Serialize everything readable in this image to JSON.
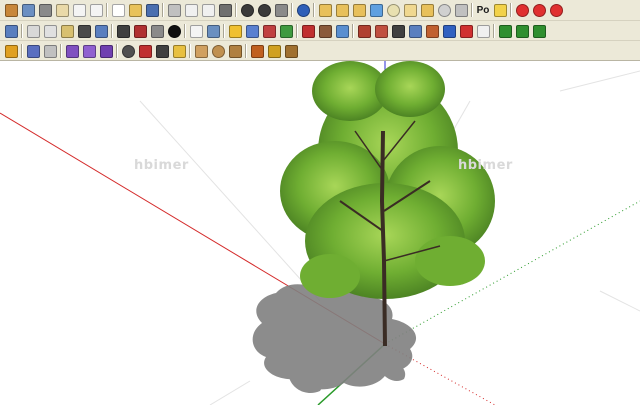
{
  "toolbar": {
    "row1": [
      {
        "name": "box-icon",
        "color": "#c8873a",
        "shape": "square"
      },
      {
        "name": "book-icon",
        "color": "#6b8fc2",
        "shape": "square"
      },
      {
        "name": "house-icon",
        "color": "#8a8a8a",
        "shape": "square"
      },
      {
        "name": "box-front-icon",
        "color": "#e9d9a8",
        "shape": "square"
      },
      {
        "name": "house-outline-icon",
        "color": "#f4f4f4",
        "shape": "square"
      },
      {
        "name": "house-outline-2-icon",
        "color": "#f4f4f4",
        "shape": "square"
      },
      {
        "sep": true
      },
      {
        "name": "new-file-icon",
        "color": "#ffffff",
        "shape": "square"
      },
      {
        "name": "open-folder-icon",
        "color": "#e8c25a",
        "shape": "square"
      },
      {
        "name": "save-disk-icon",
        "color": "#4a6fb0",
        "shape": "square"
      },
      {
        "sep": true
      },
      {
        "name": "cut-scissors-icon",
        "color": "#c0c0c0",
        "shape": "square"
      },
      {
        "name": "copy-icon",
        "color": "#f0f0f0",
        "shape": "square"
      },
      {
        "name": "paste-icon",
        "color": "#f0f0f0",
        "shape": "square"
      },
      {
        "name": "delete-x-icon",
        "color": "#6f6f6f",
        "shape": "square"
      },
      {
        "sep": true
      },
      {
        "name": "undo-icon",
        "color": "#3a3a3a",
        "shape": "circle"
      },
      {
        "name": "redo-icon",
        "color": "#3a3a3a",
        "shape": "circle"
      },
      {
        "name": "print-icon",
        "color": "#8a8a8a",
        "shape": "square"
      },
      {
        "sep": true
      },
      {
        "name": "model-info-icon",
        "color": "#2f5fb8",
        "shape": "circle"
      },
      {
        "sep": true
      },
      {
        "name": "tag-icon",
        "color": "#e8c05a",
        "shape": "square"
      },
      {
        "name": "tag-2-icon",
        "color": "#e8c05a",
        "shape": "square"
      },
      {
        "name": "tag-3-icon",
        "color": "#e8c05a",
        "shape": "square"
      },
      {
        "name": "cube-blue-icon",
        "color": "#5fa0e0",
        "shape": "square"
      },
      {
        "name": "sphere-icon",
        "color": "#e8e0b0",
        "shape": "circle"
      },
      {
        "name": "cylinder-icon",
        "color": "#f0d890",
        "shape": "square"
      },
      {
        "name": "cube-yellow-icon",
        "color": "#e8c05a",
        "shape": "square"
      },
      {
        "name": "ring-icon",
        "color": "#d0d0d0",
        "shape": "circle"
      },
      {
        "name": "cube-gray-icon",
        "color": "#c0c0c0",
        "shape": "square"
      },
      {
        "sep": true
      },
      {
        "name": "po-label",
        "text": "Po"
      },
      {
        "name": "yellow-x-icon",
        "color": "#f2d24a",
        "shape": "square"
      },
      {
        "sep": true
      },
      {
        "name": "red-ball-icon",
        "color": "#e03030",
        "shape": "circle"
      },
      {
        "name": "red-ball-2-icon",
        "color": "#e03030",
        "shape": "circle"
      },
      {
        "name": "red-ball-3-icon",
        "color": "#e03030",
        "shape": "circle"
      }
    ],
    "row2": [
      {
        "name": "iso-view-icon",
        "color": "#5a7fbf",
        "shape": "square"
      },
      {
        "sep": true
      },
      {
        "name": "top-view-icon",
        "color": "#d8d8d8",
        "shape": "square"
      },
      {
        "name": "front-view-icon",
        "color": "#e0e0e0",
        "shape": "square"
      },
      {
        "name": "right-view-icon",
        "color": "#d8c070",
        "shape": "square"
      },
      {
        "name": "back-view-icon",
        "color": "#4a4a4a",
        "shape": "square"
      },
      {
        "name": "left-view-icon",
        "color": "#5a7fbf",
        "shape": "square"
      },
      {
        "sep": true
      },
      {
        "name": "shaded-icon",
        "color": "#404040",
        "shape": "square"
      },
      {
        "name": "texture-grid-icon",
        "color": "#b03030",
        "shape": "square"
      },
      {
        "name": "xray-icon",
        "color": "#8a8a8a",
        "shape": "square"
      },
      {
        "name": "black-sphere-icon",
        "color": "#101010",
        "shape": "circle"
      },
      {
        "sep": true
      },
      {
        "name": "curve-tool-icon",
        "color": "#f4f4f4",
        "shape": "square"
      },
      {
        "name": "follow-icon",
        "color": "#6a8fc0",
        "shape": "square"
      },
      {
        "sep": true
      },
      {
        "name": "pencil-yellow-icon",
        "color": "#f0c030",
        "shape": "square"
      },
      {
        "name": "eraser-icon",
        "color": "#5a80d0",
        "shape": "square"
      },
      {
        "name": "paint-bucket-icon",
        "color": "#c04040",
        "shape": "square"
      },
      {
        "name": "component-green-icon",
        "color": "#3f9a3f",
        "shape": "square"
      },
      {
        "sep": true
      },
      {
        "name": "red-axes-icon",
        "color": "#c03030",
        "shape": "square"
      },
      {
        "name": "section-icon",
        "color": "#8a5a3a",
        "shape": "square"
      },
      {
        "name": "layers-icon",
        "color": "#5a8fd0",
        "shape": "square"
      },
      {
        "sep": true
      },
      {
        "name": "compass-icon",
        "color": "#b04030",
        "shape": "square"
      },
      {
        "name": "walk-icon",
        "color": "#c05040",
        "shape": "square"
      },
      {
        "name": "pen-icon",
        "color": "#404040",
        "shape": "square"
      },
      {
        "name": "gear-icon",
        "color": "#5a7fbf",
        "shape": "square"
      },
      {
        "name": "brick-icon",
        "color": "#c06030",
        "shape": "square"
      },
      {
        "name": "blue-grid-icon",
        "color": "#3060c0",
        "shape": "square"
      },
      {
        "name": "xbox-red-icon",
        "color": "#d03030",
        "shape": "square"
      },
      {
        "name": "paper-icon",
        "color": "#f0f0f0",
        "shape": "square"
      },
      {
        "sep": true
      },
      {
        "name": "green-s-icon",
        "color": "#2f8f2f",
        "shape": "square"
      },
      {
        "name": "green-t-icon",
        "color": "#2f8f2f",
        "shape": "square"
      },
      {
        "name": "green-c-icon",
        "color": "#2f8f2f",
        "shape": "square"
      }
    ],
    "row3": [
      {
        "name": "pencil-icon",
        "color": "#e0a020",
        "shape": "square"
      },
      {
        "sep": true
      },
      {
        "name": "spray-icon",
        "color": "#5a6fc0",
        "shape": "square"
      },
      {
        "name": "window-icon",
        "color": "#c0c0c0",
        "shape": "square"
      },
      {
        "sep": true
      },
      {
        "name": "purple-cube-icon",
        "color": "#8050c0",
        "shape": "square"
      },
      {
        "name": "purple-cube-2-icon",
        "color": "#9060d0",
        "shape": "square"
      },
      {
        "name": "purple-cube-3-icon",
        "color": "#7040b0",
        "shape": "square"
      },
      {
        "sep": true
      },
      {
        "name": "arc-tool-icon",
        "color": "#505050",
        "shape": "circle"
      },
      {
        "name": "red-tool-icon",
        "color": "#c03030",
        "shape": "square"
      },
      {
        "name": "measure-icon",
        "color": "#404040",
        "shape": "square"
      },
      {
        "name": "yellow-pen-icon",
        "color": "#e8c040",
        "shape": "square"
      },
      {
        "sep": true
      },
      {
        "name": "cone-icon",
        "color": "#d0a060",
        "shape": "square"
      },
      {
        "name": "sphere-brown-icon",
        "color": "#c09050",
        "shape": "circle"
      },
      {
        "name": "pyramid-icon",
        "color": "#b08040",
        "shape": "square"
      },
      {
        "sep": true
      },
      {
        "name": "orange-ring-icon",
        "color": "#c06020",
        "shape": "square"
      },
      {
        "name": "yellow-q-icon",
        "color": "#d0a020",
        "shape": "square"
      },
      {
        "name": "brown-tool-icon",
        "color": "#a07030",
        "shape": "square"
      }
    ]
  },
  "viewport": {
    "watermark_left": "hbimer",
    "watermark_right": "hbimer",
    "axis_colors": {
      "red": "#d42a2a",
      "green": "#2a9a2a",
      "blue": "#2a2ad4"
    },
    "tree_colors": {
      "light": "#8cc43f",
      "mid": "#5f9a2e",
      "dark": "#3d6e1e",
      "trunk": "#3a2c24",
      "shadow": "#7f7f7f"
    }
  }
}
